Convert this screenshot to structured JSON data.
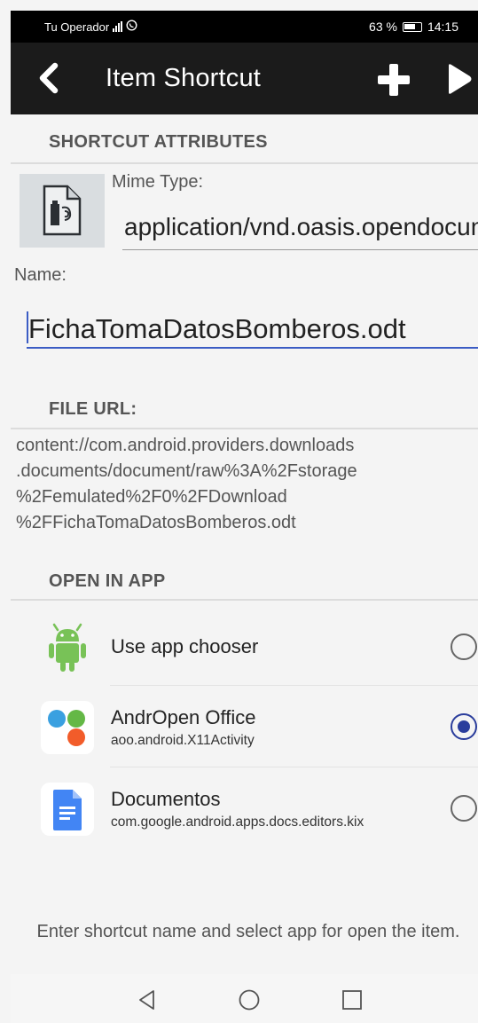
{
  "status_bar": {
    "carrier": "Tu Operador",
    "battery": "63 %",
    "time": "14:15"
  },
  "app_bar": {
    "title": "Item Shortcut",
    "back_icon": "chevron-left-icon",
    "add_icon": "plus-icon",
    "run_icon": "play-icon"
  },
  "attributes": {
    "section_label": "SHORTCUT ATTRIBUTES",
    "mime_label": "Mime Type:",
    "mime_value": "application/vnd.oasis.opendocument.text",
    "name_label": "Name:",
    "name_value": "FichaTomaDatosBomberos.odt"
  },
  "file_url": {
    "section_label": "FILE URL:",
    "lines": [
      "content://com.android.providers.downloads",
      ".documents/document/raw%3A%2Fstorage",
      "%2Femulated%2F0%2FDownload",
      "%2FFichaTomaDatosBomberos.odt"
    ]
  },
  "open_in_app": {
    "section_label": "OPEN IN APP",
    "apps": [
      {
        "name": "Use app chooser",
        "package": "",
        "icon": "android-icon",
        "selected": false
      },
      {
        "name": "AndrOpen Office",
        "package": "aoo.android.X11Activity",
        "icon": "andropen-office-icon",
        "selected": true
      },
      {
        "name": "Documentos",
        "package": "com.google.android.apps.docs.editors.kix",
        "icon": "google-docs-icon",
        "selected": false
      }
    ]
  },
  "hint": "Enter shortcut name and select app for open the item.",
  "colors": {
    "accent": "#2a3d9c",
    "input_underline": "#3b5cc4",
    "app_bar": "#1b1b1b",
    "android_green": "#78c257"
  }
}
